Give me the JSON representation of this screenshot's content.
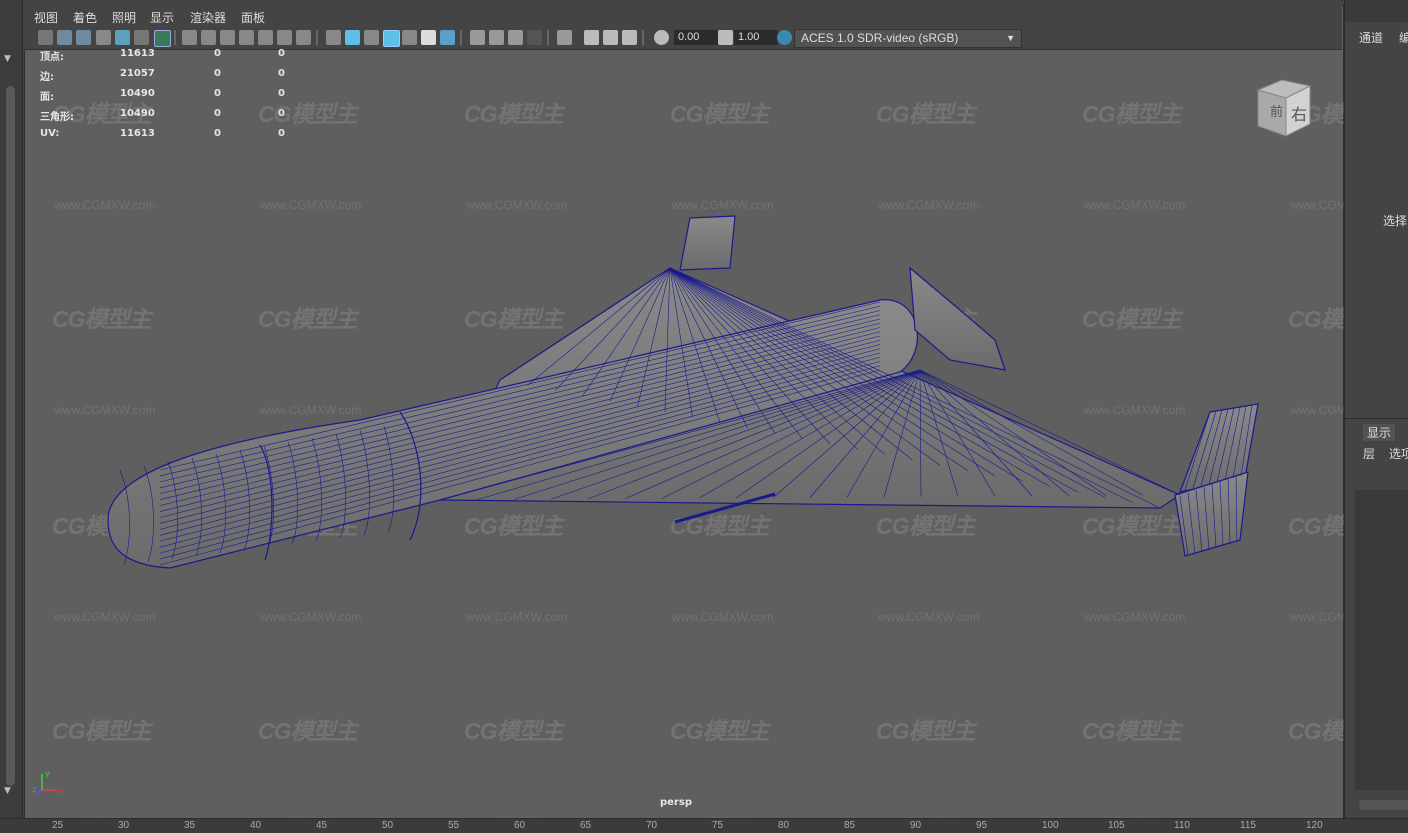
{
  "menu": [
    "视图",
    "着色",
    "照明",
    "显示",
    "渲染器",
    "面板"
  ],
  "toolbar": {
    "exposure": "0.00",
    "gamma": "1.00",
    "colorspace": "ACES 1.0 SDR-video (sRGB)"
  },
  "hud": {
    "rows": [
      {
        "label": "顶点:",
        "values": [
          "11613",
          "0",
          "0"
        ]
      },
      {
        "label": "边:",
        "values": [
          "21057",
          "0",
          "0"
        ]
      },
      {
        "label": "面:",
        "values": [
          "10490",
          "0",
          "0"
        ]
      },
      {
        "label": "三角形:",
        "values": [
          "10490",
          "0",
          "0"
        ]
      },
      {
        "label": "UV:",
        "values": [
          "11613",
          "0",
          "0"
        ]
      }
    ]
  },
  "viewcube": {
    "front": "前",
    "right": "右"
  },
  "camera_label": "persp",
  "axes": {
    "x": "x",
    "y": "y",
    "z": "z"
  },
  "watermark": {
    "logo": "CG模型主",
    "url": "www.CGMXW.com"
  },
  "right_panel": {
    "tab_channel": "通道",
    "tab_edit": "编",
    "select": "选择",
    "tab_display": "显示",
    "layer": "层",
    "options": "选项"
  },
  "ruler": [
    "25",
    "30",
    "35",
    "40",
    "45",
    "50",
    "55",
    "60",
    "65",
    "70",
    "75",
    "80",
    "85",
    "90",
    "95",
    "100",
    "105",
    "110",
    "115",
    "120"
  ],
  "colors": {
    "wire": "#1a1a8c",
    "viewport": "#5f5f5f",
    "ui": "#444444"
  }
}
